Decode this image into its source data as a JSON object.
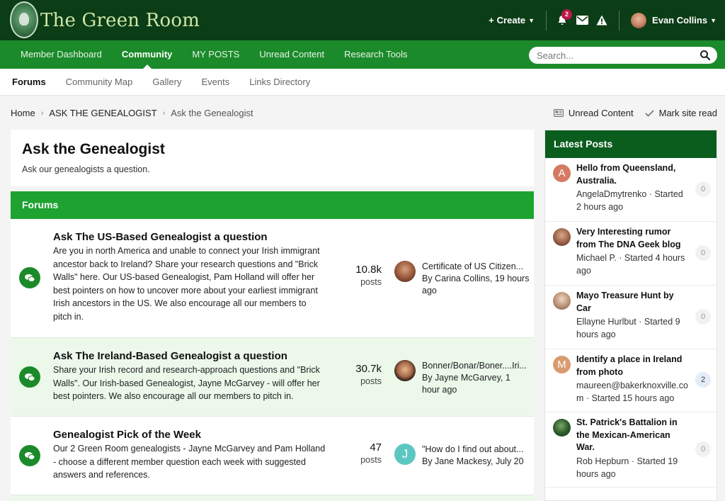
{
  "header": {
    "site_title": "The Green Room",
    "create_label": "Create",
    "notifications_count": "2",
    "user_name": "Evan Collins"
  },
  "nav": {
    "items": [
      {
        "label": "Member Dashboard"
      },
      {
        "label": "Community"
      },
      {
        "label": "MY POSTS"
      },
      {
        "label": "Unread Content"
      },
      {
        "label": "Research Tools"
      }
    ],
    "search_placeholder": "Search..."
  },
  "subnav": {
    "items": [
      {
        "label": "Forums"
      },
      {
        "label": "Community Map"
      },
      {
        "label": "Gallery"
      },
      {
        "label": "Events"
      },
      {
        "label": "Links Directory"
      }
    ]
  },
  "breadcrumb": {
    "home": "Home",
    "section": "ASK THE GENEALOGIST",
    "current": "Ask the Genealogist",
    "unread_label": "Unread Content",
    "mark_read_label": "Mark site read"
  },
  "page": {
    "title": "Ask the Genealogist",
    "description": "Ask our genealogists a question.",
    "forums_header": "Forums"
  },
  "forums": [
    {
      "title": "Ask The US-Based Genealogist a question",
      "description": "Are you in north America and unable to connect your Irish immigrant ancestor back to Ireland? Share your research questions and \"Brick Walls\" here. Our US-based Genealogist, Pam Holland will offer her best pointers on how to uncover more about your earliest immigrant Irish ancestors in the US. We also encourage all our members to pitch in.",
      "count": "10.8k",
      "count_label": "posts",
      "last_title": "Certificate of US Citizen...",
      "last_meta": "By Carina Collins, 19 hours ago"
    },
    {
      "title": "Ask The Ireland-Based Genealogist a question",
      "description": "Share your Irish record and research-approach questions and \"Brick Walls\". Our Irish-based Genealogist, Jayne McGarvey - will offer her best pointers. We also encourage all our members to pitch in.",
      "count": "30.7k",
      "count_label": "posts",
      "last_title": "Bonner/Bonar/Boner....Iri...",
      "last_meta": "By Jayne McGarvey, 1 hour ago"
    },
    {
      "title": "Genealogist Pick of the Week",
      "description": "Our 2 Green Room genealogists - Jayne McGarvey and Pam Holland - choose a different member question each week with suggested answers and references.",
      "count": "47",
      "count_label": "posts",
      "last_title": "\"How do I find out about...",
      "last_meta": "By Jane Mackesy, July 20",
      "avatar_letter": "J"
    }
  ],
  "sidebar": {
    "title": "Latest Posts",
    "posts": [
      {
        "title": "Hello from Queensland, Australia.",
        "meta": "AngelaDmytrenko · Started 2 hours ago",
        "count": "0",
        "avatar_letter": "A"
      },
      {
        "title": "Very Interesting rumor from The DNA Geek blog",
        "meta": "Michael P. · Started 4 hours ago",
        "count": "0"
      },
      {
        "title": "Mayo Treasure Hunt by Car",
        "meta": "Ellayne Hurlbut · Started 9 hours ago",
        "count": "0"
      },
      {
        "title": "Identify a place in Ireland from photo",
        "meta": "maureen@bakerknoxville.com · Started 15 hours ago",
        "count": "2",
        "avatar_letter": "M"
      },
      {
        "title": "St. Patrick's Battalion in the Mexican-American War.",
        "meta": "Rob Hepburn · Started 19 hours ago",
        "count": "0"
      }
    ]
  }
}
